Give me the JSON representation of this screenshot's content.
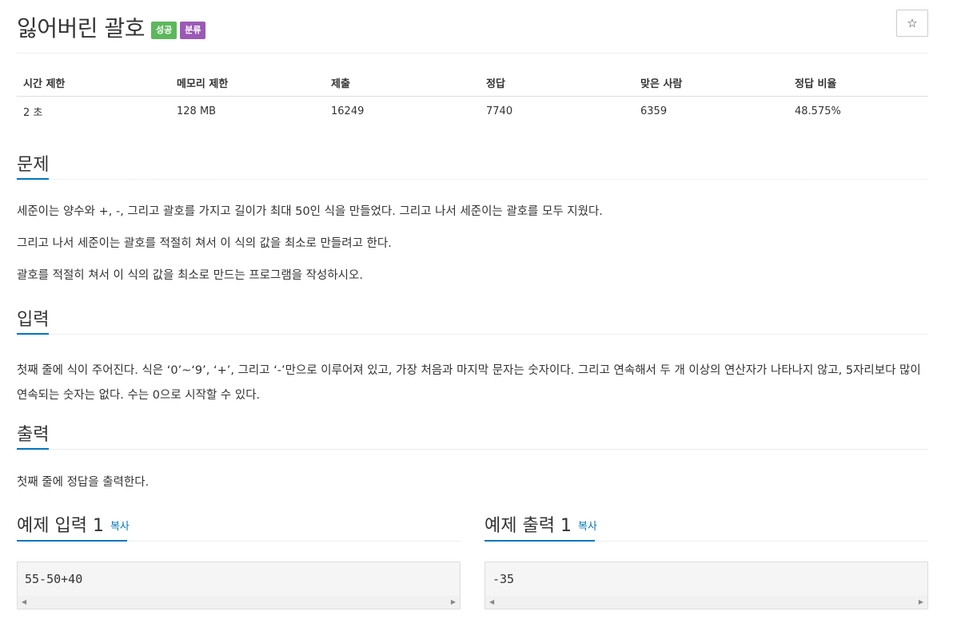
{
  "problem": {
    "title": "잃어버린 괄호",
    "badges": {
      "success": "성공",
      "category": "분류"
    },
    "star_icon": "☆"
  },
  "info": {
    "headers": [
      "시간 제한",
      "메모리 제한",
      "제출",
      "정답",
      "맞은 사람",
      "정답 비율"
    ],
    "values": [
      "2 초",
      "128 MB",
      "16249",
      "7740",
      "6359",
      "48.575%"
    ]
  },
  "description": {
    "heading": "문제",
    "paragraphs": [
      "세준이는 양수와 +, -, 그리고 괄호를 가지고 길이가 최대 50인 식을 만들었다. 그리고 나서 세준이는 괄호를 모두 지웠다.",
      "그리고 나서 세준이는 괄호를 적절히 쳐서 이 식의 값을 최소로 만들려고 한다.",
      "괄호를 적절히 쳐서 이 식의 값을 최소로 만드는 프로그램을 작성하시오."
    ]
  },
  "input": {
    "heading": "입력",
    "text": "첫째 줄에 식이 주어진다. 식은 ‘0’~‘9’, ‘+’, 그리고 ‘-’만으로 이루어져 있고, 가장 처음과 마지막 문자는 숫자이다. 그리고 연속해서 두 개 이상의 연산자가 나타나지 않고, 5자리보다 많이 연속되는 숫자는 없다. 수는 0으로 시작할 수 있다."
  },
  "output": {
    "heading": "출력",
    "text": "첫째 줄에 정답을 출력한다."
  },
  "samples": {
    "input": {
      "heading": "예제 입력 1",
      "copy": "복사",
      "code": "55-50+40"
    },
    "output": {
      "heading": "예제 출력 1",
      "copy": "복사",
      "code": "-35"
    }
  },
  "colors": {
    "accent": "#0076c0",
    "success": "#5cb85c",
    "category": "#9b59b6"
  }
}
